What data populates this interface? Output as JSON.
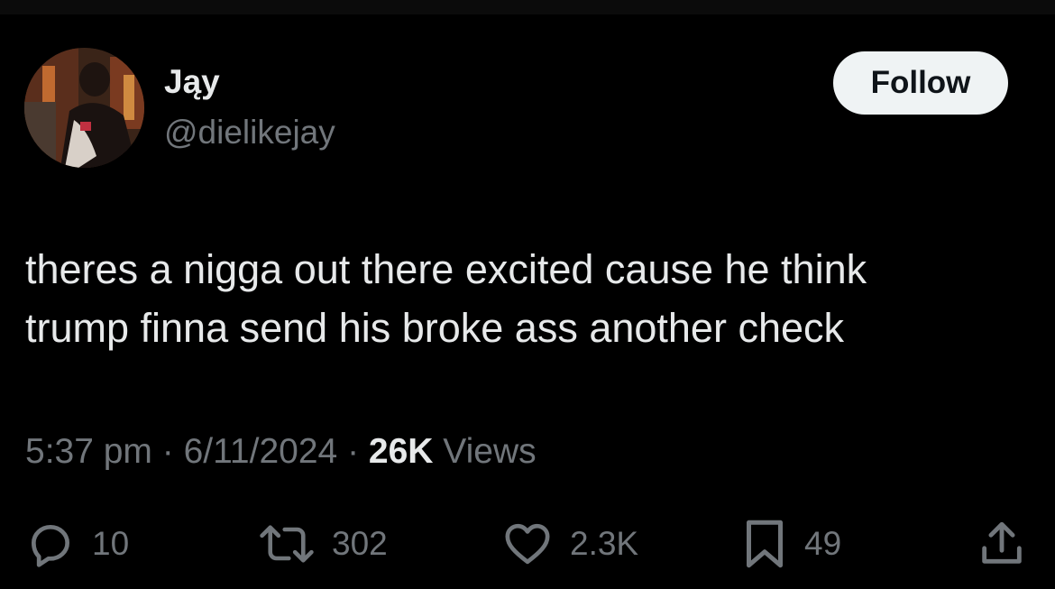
{
  "tweet": {
    "author": {
      "display_name": "Jąy",
      "handle": "@dielikejay"
    },
    "follow_label": "Follow",
    "text_lines": [
      "theres a nigga out there excited cause he think",
      "trump finna send his broke ass another check"
    ],
    "meta": {
      "time": "5:37 pm",
      "separator": "·",
      "date": "6/11/2024",
      "views_count": "26K",
      "views_label": "Views"
    },
    "actions": {
      "replies": "10",
      "reposts": "302",
      "likes": "2.3K",
      "bookmarks": "49"
    },
    "icons": {
      "reply": "reply-icon",
      "repost": "repost-icon",
      "like": "heart-icon",
      "bookmark": "bookmark-icon",
      "share": "share-icon"
    },
    "colors": {
      "background": "#000000",
      "primary_text": "#e7e9ea",
      "secondary_text": "#71767b",
      "follow_button_bg": "#eff3f4",
      "follow_button_text": "#0f1419"
    }
  }
}
